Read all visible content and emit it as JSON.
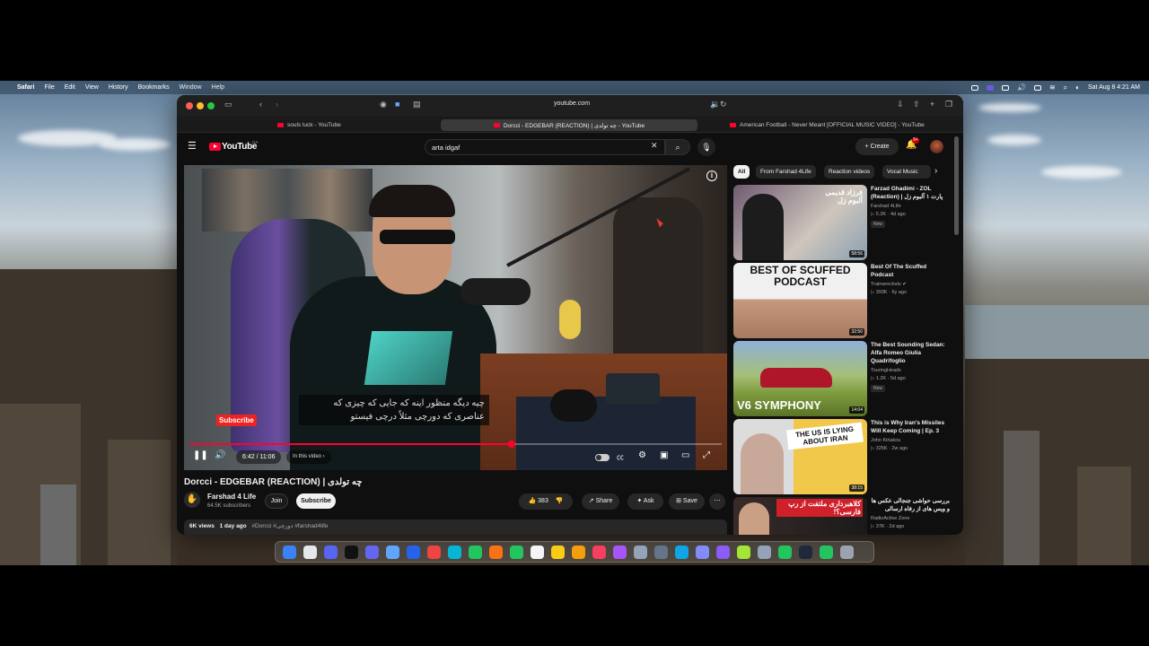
{
  "menubar": {
    "app": "Safari",
    "items": [
      "File",
      "Edit",
      "View",
      "History",
      "Bookmarks",
      "Window",
      "Help"
    ],
    "clock": "Sat Aug 8  4:21 AM"
  },
  "browser": {
    "address": "youtube.com",
    "tabs": [
      {
        "label": "souls luck - YouTube"
      },
      {
        "label": "Dorcci - EDGEBAR (REACTION) | چه تولدی - YouTube"
      },
      {
        "label": "American Football - Never Meant [OFFICIAL MUSIC VIDEO] - YouTube"
      }
    ]
  },
  "youtube": {
    "logo": "YouTube",
    "region": "CA",
    "search_value": "arta idgaf",
    "create_label": "+ Create",
    "notif_count": "9+"
  },
  "player": {
    "caption_line1": "چیه دیگه منظور اینه که جایی که چیزی که",
    "caption_line2": "عناصری که دورچی مثلاً درچی فیستو",
    "subscribe_overlay": "Subscribe",
    "time": "6:42 / 11:06",
    "in_this_video": "In this video ›",
    "progress_fraction": 0.605
  },
  "video": {
    "title": "Dorcci - EDGEBAR (REACTION) | چه تولدی",
    "channel": "Farshad 4 Life",
    "subscribers": "64.5K subscribers",
    "join_label": "Join",
    "subscribe_label": "Subscribe",
    "likes": "383",
    "share_label": "Share",
    "ask_label": "Ask",
    "save_label": "Save",
    "views": "6K views",
    "age": "1 day ago",
    "hashtags": "#Dorcci #دورچی #farshad4life"
  },
  "sidebar": {
    "chips": [
      "All",
      "From Farshad 4Life",
      "Reaction videos",
      "Vocal Music"
    ],
    "recommendations": [
      {
        "title": "Farzad Ghadimi - ZOL (Reaction) | پارت ۱ آلبوم زل",
        "channel": "Farshad 4Life",
        "meta": "▷ 5.2K · 4d ago",
        "badge": "New",
        "duration": "58:56",
        "thumb_text": "فرزاد قدیمی آلبوم زل"
      },
      {
        "title": "Best Of The Scuffed Podcast",
        "channel": "Trainwreckstv ✔",
        "meta": "▷ 393K · 6y ago",
        "badge": "",
        "duration": "32:50",
        "thumb_text": "BEST OF SCUFFED PODCAST"
      },
      {
        "title": "The Best Sounding Sedan: Alfa Romeo Giulia Quadrifoglio",
        "channel": "TouringHeads",
        "meta": "▷ 1.2K · 5d ago",
        "badge": "New",
        "duration": "14:04",
        "thumb_text": "V6 SYMPHONY"
      },
      {
        "title": "This is Why Iran's Missiles Will Keep Coming | Ep. 3",
        "channel": "John Kiriakou",
        "meta": "▷ 325K · 2w ago",
        "badge": "",
        "duration": "38:15",
        "thumb_text": "THE US IS LYING ABOUT IRAN"
      },
      {
        "title": "بررسی حواشی جنجالی عکس ها و ویس های از رفاه ارسالی",
        "channel": "RadioActive Zone",
        "meta": "▷ 37K · 2d ago",
        "badge": "",
        "duration": "",
        "thumb_text": "کلاهبرداری ملتفت از رپ فارسی؟!"
      }
    ]
  },
  "colors": {
    "youtube_red": "#ff0033",
    "bg": "#0f0f0f",
    "chip": "#272727"
  }
}
